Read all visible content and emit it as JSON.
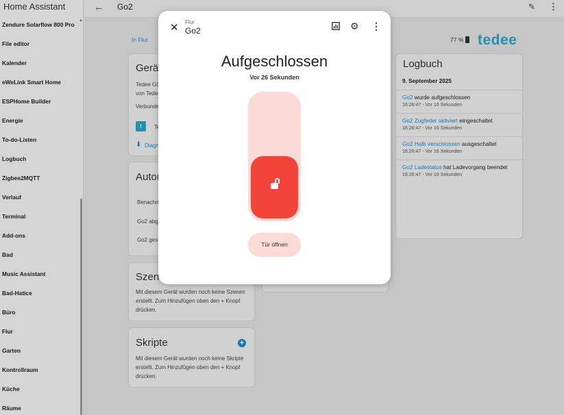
{
  "sidebar": {
    "title": "Home Assistant",
    "items": [
      {
        "label": "Zendure Solarflow 800 Pro"
      },
      {
        "label": "File editor"
      },
      {
        "label": "Kalender"
      },
      {
        "label": "eWeLink Smart Home"
      },
      {
        "label": "ESPHome Builder"
      },
      {
        "label": "Energie"
      },
      {
        "label": "To-do-Listen"
      },
      {
        "label": "Logbuch"
      },
      {
        "label": "Zigbee2MQTT"
      },
      {
        "label": "Verlauf"
      },
      {
        "label": "Terminal"
      },
      {
        "label": "Add-ons"
      },
      {
        "label": "Bad"
      },
      {
        "label": "Music Assistant"
      },
      {
        "label": "Bad-Hatice"
      },
      {
        "label": "Büro"
      },
      {
        "label": "Flur"
      },
      {
        "label": "Garten"
      },
      {
        "label": "Kontrollraum"
      },
      {
        "label": "Küche"
      },
      {
        "label": "Räume"
      }
    ]
  },
  "header": {
    "title": "Go2"
  },
  "page": {
    "breadcrumb": "In Flur",
    "battery": "77 %",
    "brand": "tedee"
  },
  "device_card": {
    "title": "Gerät",
    "line1": "Tedee GO",
    "line2": "von Tedee",
    "connected": "Verbunde",
    "integration": "Te",
    "download": "Diagn"
  },
  "automation_card": {
    "title": "Autom",
    "items": [
      {
        "label": "Benachri"
      },
      {
        "label": "Go2 abg"
      },
      {
        "label": "Go2 ges"
      }
    ]
  },
  "scenes_card": {
    "title": "Szene",
    "text": "Mit diesem Gerät wurden noch keine Szenen erstellt. Zum Hinzufügen oben den + Knopf drücken."
  },
  "scripts_card": {
    "title": "Skripte",
    "text": "Mit diesem Gerät wurden noch keine Skripte erstellt. Zum Hinzufügen oben den + Knopf drücken."
  },
  "logbook": {
    "title": "Logbuch",
    "date": "9. September 2025",
    "entries": [
      {
        "link": "Go2",
        "text": " wurde aufgeschlossen",
        "time": "16:26:47 - Vor 16 Sekunden"
      },
      {
        "link": "Go2 Zugfeder aktiviert",
        "text": " eingeschaltet",
        "time": "16:26:47 - Vor 16 Sekunden"
      },
      {
        "link": "Go2 Halb verschlossen",
        "text": " ausgeschaltet",
        "time": "16:26:47 - Vor 16 Sekunden"
      },
      {
        "link": "Go2 Ladestatus",
        "text": " hat Ladevorgang beendet",
        "time": "16:26:47 - Vor 16 Sekunden"
      }
    ]
  },
  "dialog": {
    "area": "Flur",
    "name": "Go2",
    "state": "Aufgeschlossen",
    "since": "Vor 26 Sekunden",
    "open_door": "Tür öffnen",
    "close_icon": "close-icon",
    "history_icon": "chart-icon",
    "settings_icon": "gear-icon",
    "menu_icon": "more-vert-icon"
  },
  "colors": {
    "accent": "#2a8ac8",
    "brand": "#2aa5c6",
    "lock_active": "#f3443a",
    "lock_track": "#fcdad6"
  }
}
